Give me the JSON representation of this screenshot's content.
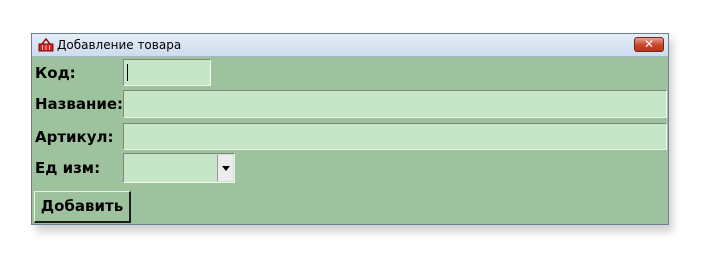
{
  "window": {
    "title": "Добавление товара",
    "close_label": "✕",
    "icon": "basket-icon"
  },
  "form": {
    "code_label": "Код:",
    "code_value": "",
    "name_label": "Название:",
    "name_value": "",
    "article_label": "Артикул:",
    "article_value": "",
    "unit_label": "Ед изм:",
    "unit_value": ""
  },
  "actions": {
    "add_label": "Добавить"
  },
  "colors": {
    "window_bg": "#9ec29e",
    "field_bg": "#c7e6c7"
  }
}
